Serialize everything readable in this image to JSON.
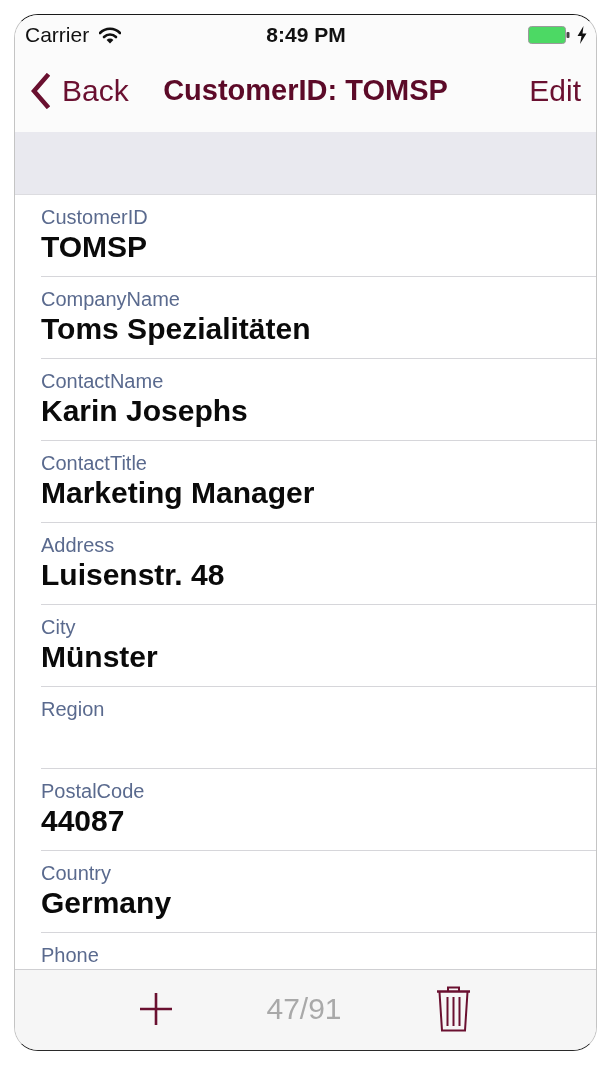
{
  "status_bar": {
    "carrier": "Carrier",
    "time": "8:49 PM",
    "charging": true
  },
  "nav_bar": {
    "back": "Back",
    "title": "CustomerID: TOMSP",
    "action": "Edit"
  },
  "fields": [
    {
      "label": "CustomerID",
      "value": "TOMSP"
    },
    {
      "label": "CompanyName",
      "value": "Toms Spezialitäten"
    },
    {
      "label": "ContactName",
      "value": "Karin Josephs"
    },
    {
      "label": "ContactTitle",
      "value": "Marketing Manager"
    },
    {
      "label": "Address",
      "value": "Luisenstr. 48"
    },
    {
      "label": "City",
      "value": "Münster"
    },
    {
      "label": "Region"
    },
    {
      "label": "PostalCode",
      "value": "44087"
    },
    {
      "label": "Country",
      "value": "Germany"
    },
    {
      "label": "Phone"
    }
  ],
  "toolbar": {
    "counter": "47/91"
  }
}
